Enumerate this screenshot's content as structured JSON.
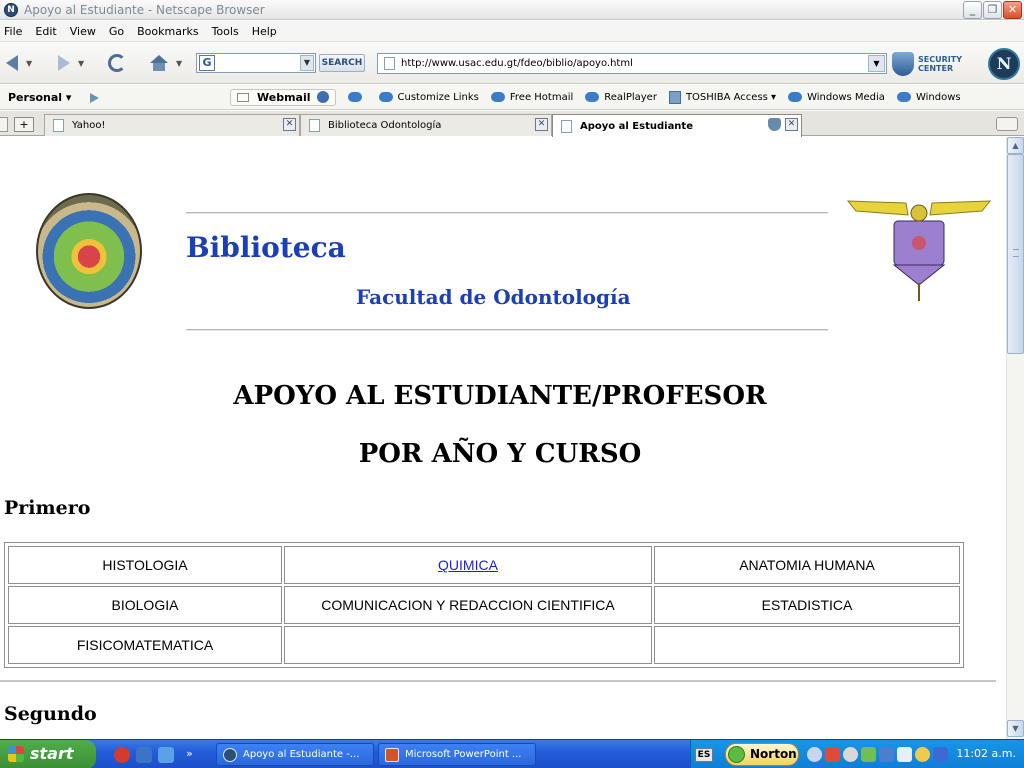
{
  "window": {
    "title": "Apoyo al Estudiante - Netscape Browser"
  },
  "menu": [
    "File",
    "Edit",
    "View",
    "Go",
    "Bookmarks",
    "Tools",
    "Help"
  ],
  "toolbar": {
    "search_placeholder": "",
    "search_label": "SEARCH",
    "url": "http://www.usac.edu.gt/fdeo/biblio/apoyo.html",
    "security_line1": "SECURITY",
    "security_line2": "CENTER",
    "logo_letter": "N"
  },
  "personal_bar": {
    "label": "Personal",
    "webmail": "Webmail",
    "bookmarks": [
      "Customize Links",
      "Free Hotmail",
      "RealPlayer",
      "TOSHIBA Access",
      "Windows Media",
      "Windows"
    ]
  },
  "tabs": [
    {
      "label": "Yahoo!",
      "active": false
    },
    {
      "label": "Biblioteca Odontología",
      "active": false
    },
    {
      "label": "Apoyo al Estudiante",
      "active": true
    }
  ],
  "page": {
    "brand": "Biblioteca",
    "faculty": "Facultad de Odontología",
    "heading1": "APOYO AL ESTUDIANTE/PROFESOR",
    "heading2": "POR AÑO Y CURSO",
    "sections": [
      {
        "name": "Primero",
        "rows": [
          [
            {
              "text": "HISTOLOGIA",
              "link": false
            },
            {
              "text": "QUIMICA",
              "link": true
            },
            {
              "text": "ANATOMIA HUMANA",
              "link": false
            }
          ],
          [
            {
              "text": "BIOLOGIA",
              "link": false
            },
            {
              "text": "COMUNICACION Y REDACCION CIENTIFICA",
              "link": false
            },
            {
              "text": "ESTADISTICA",
              "link": false
            }
          ],
          [
            {
              "text": "FISICOMATEMATICA",
              "link": false
            },
            {
              "text": "",
              "link": false
            },
            {
              "text": "",
              "link": false
            }
          ]
        ]
      },
      {
        "name": "Segundo"
      }
    ]
  },
  "taskbar": {
    "start": "start",
    "tasks": [
      "Apoyo al Estudiante -...",
      "Microsoft PowerPoint ..."
    ],
    "lang": "ES",
    "norton": "Norton",
    "clock": "11:02 a.m."
  }
}
